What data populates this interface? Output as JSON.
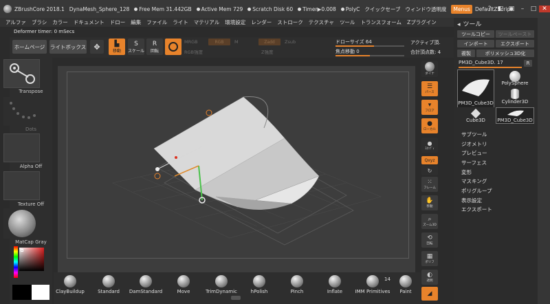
{
  "titlebar": {
    "app": "ZBrushCore 2018.1",
    "doc": "DynaMesh_Sphere_128",
    "free_mem": "Free Mem 31.442GB",
    "active_mem": "Active Mem 729",
    "scratch": "Scratch Disk 60",
    "timer": "Timer▶0.008",
    "polycount": "PolyC",
    "quicksave": "クイックセーブ",
    "transparent": "ウィンドウ透明度",
    "menus": "Menus",
    "script": "DefaultZScript"
  },
  "menubar": [
    "アルファ",
    "ブラシ",
    "カラー",
    "ドキュメント",
    "ドロー",
    "編集",
    "ファイル",
    "ライト",
    "マテリアル",
    "環境設定",
    "レンダー",
    "ストローク",
    "テクスチャ",
    "ツール",
    "トランスフォーム",
    "Zプラグイン"
  ],
  "deformer_timer": "Deformer timer: 0 mSecs",
  "shelf": {
    "home": "ホームページ",
    "lightbox": "ライトボックス",
    "draw": "移動",
    "scale": "スケール",
    "rotate": "回転",
    "mrgb": "MRGB",
    "rgb": "RGB",
    "m": "M",
    "zadd": "Zadd",
    "zsub": "Zsub",
    "rgb_intensity": "RGB強度",
    "z_intensity": "Z強度",
    "draw_size_label": "ドローサイズ",
    "draw_size": "64",
    "focal_label": "焦点移動",
    "focal": "0",
    "active_points": "アクティブ頂.",
    "total_points": "合計頂点数: 4"
  },
  "left_tray": {
    "transpose": "Transpose",
    "dots": "Dots",
    "alpha": "Alpha Off",
    "texture": "Texture Off",
    "material": "MatCap Gray"
  },
  "right_strip": [
    "ダイナ",
    "パース",
    "フロア",
    "ローカル",
    "ｽﾀﾝﾃﾞｨ",
    "Qxyz",
    "",
    "フレーム",
    "移動",
    "ズーム3D",
    "回転",
    "ポリフ",
    "透明"
  ],
  "right_panel": {
    "title": "ツール",
    "tool_copy": "ツールコピー",
    "tool_paste": "ツールペースト",
    "import": "インポート",
    "export": "エクスポート",
    "clone": "複製",
    "polymesh": "ポリメッシュ3D化",
    "current_tool": "PM3D_Cube3D. 17",
    "r": "R",
    "thumbs": [
      "PM3D_Cube3D",
      "PolySphere",
      "Cylinder3D",
      "Cube3D",
      "PM3D_Cube3D"
    ],
    "menu": [
      "サブツール",
      "ジオメトリ",
      "プレビュー",
      "サーフェス",
      "変形",
      "マスキング",
      "ポリグループ",
      "表示設定",
      "エクスポート"
    ]
  },
  "brushes": [
    "ClayBuildup",
    "Standard",
    "DamStandard",
    "Move",
    "TrimDynamic",
    "hPolish",
    "Pinch",
    "Inflate",
    "IMM Primitives",
    "Paint"
  ],
  "imm_count": "14",
  "colors": {
    "accent": "#e8832b",
    "bg": "#2b2b2b",
    "canvas": "#3d3d3d",
    "desktop": "#1e6fb8"
  }
}
